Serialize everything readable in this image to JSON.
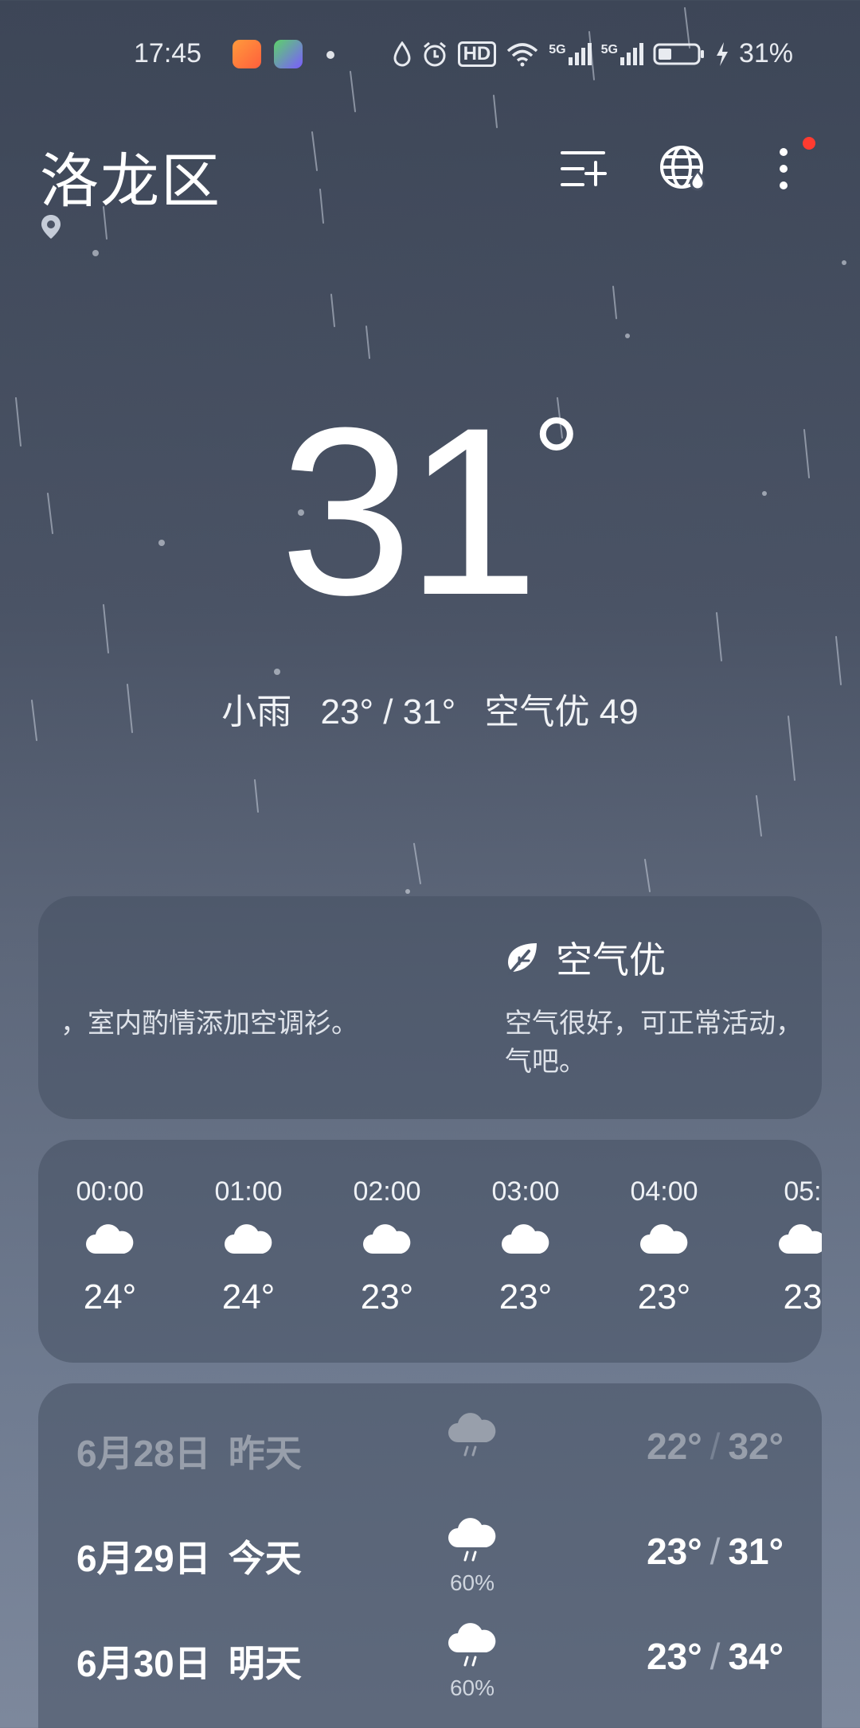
{
  "status_bar": {
    "time": "17:45",
    "battery": "31%",
    "net_1": "5G",
    "net_2": "5G",
    "hd": "HD",
    "icons": [
      "video-app-icon",
      "iqiyi-app-icon",
      "dot-icon",
      "water-drop-icon",
      "alarm-icon",
      "hd-icon",
      "wifi-icon",
      "signal-5g-icon",
      "signal-5g-icon",
      "battery-icon",
      "charging-icon"
    ]
  },
  "header": {
    "city": "洛龙区",
    "location_icon": "location-pin-icon",
    "add_city_icon": "list-add-icon",
    "globe_icon": "globe-icon",
    "more_icon": "more-vertical-icon"
  },
  "current": {
    "temperature": "31",
    "degree": "°",
    "condition": "小雨",
    "range": "23° / 31°",
    "aqi": "空气优 49"
  },
  "tips": {
    "left_text": "，室内酌情添加空调衫。",
    "right_title": "空气优",
    "right_icon": "leaf-icon",
    "right_desc": "空气很好，可正常活动，\n气吧。"
  },
  "hourly": [
    {
      "time": "00:00",
      "icon": "cloud-icon",
      "temp": "24°"
    },
    {
      "time": "01:00",
      "icon": "cloud-icon",
      "temp": "24°"
    },
    {
      "time": "02:00",
      "icon": "cloud-icon",
      "temp": "23°"
    },
    {
      "time": "03:00",
      "icon": "cloud-icon",
      "temp": "23°"
    },
    {
      "time": "04:00",
      "icon": "cloud-icon",
      "temp": "23°"
    },
    {
      "time": "05:",
      "icon": "cloud-icon",
      "temp": "23"
    }
  ],
  "daily": [
    {
      "date": "6月28日",
      "label": "昨天",
      "icon": "rain-cloud-icon",
      "pop": "",
      "low": "22°",
      "high": "32°",
      "past": true
    },
    {
      "date": "6月29日",
      "label": "今天",
      "icon": "rain-cloud-icon",
      "pop": "60%",
      "low": "23°",
      "high": "31°",
      "past": false
    },
    {
      "date": "6月30日",
      "label": "明天",
      "icon": "rain-cloud-icon",
      "pop": "60%",
      "low": "23°",
      "high": "34°",
      "past": false
    }
  ],
  "colors": {
    "background_top": "#3d4657",
    "background_bottom": "#7d889c",
    "card": "rgba(70,80,98,0.55)",
    "notification": "#ff3b30"
  }
}
